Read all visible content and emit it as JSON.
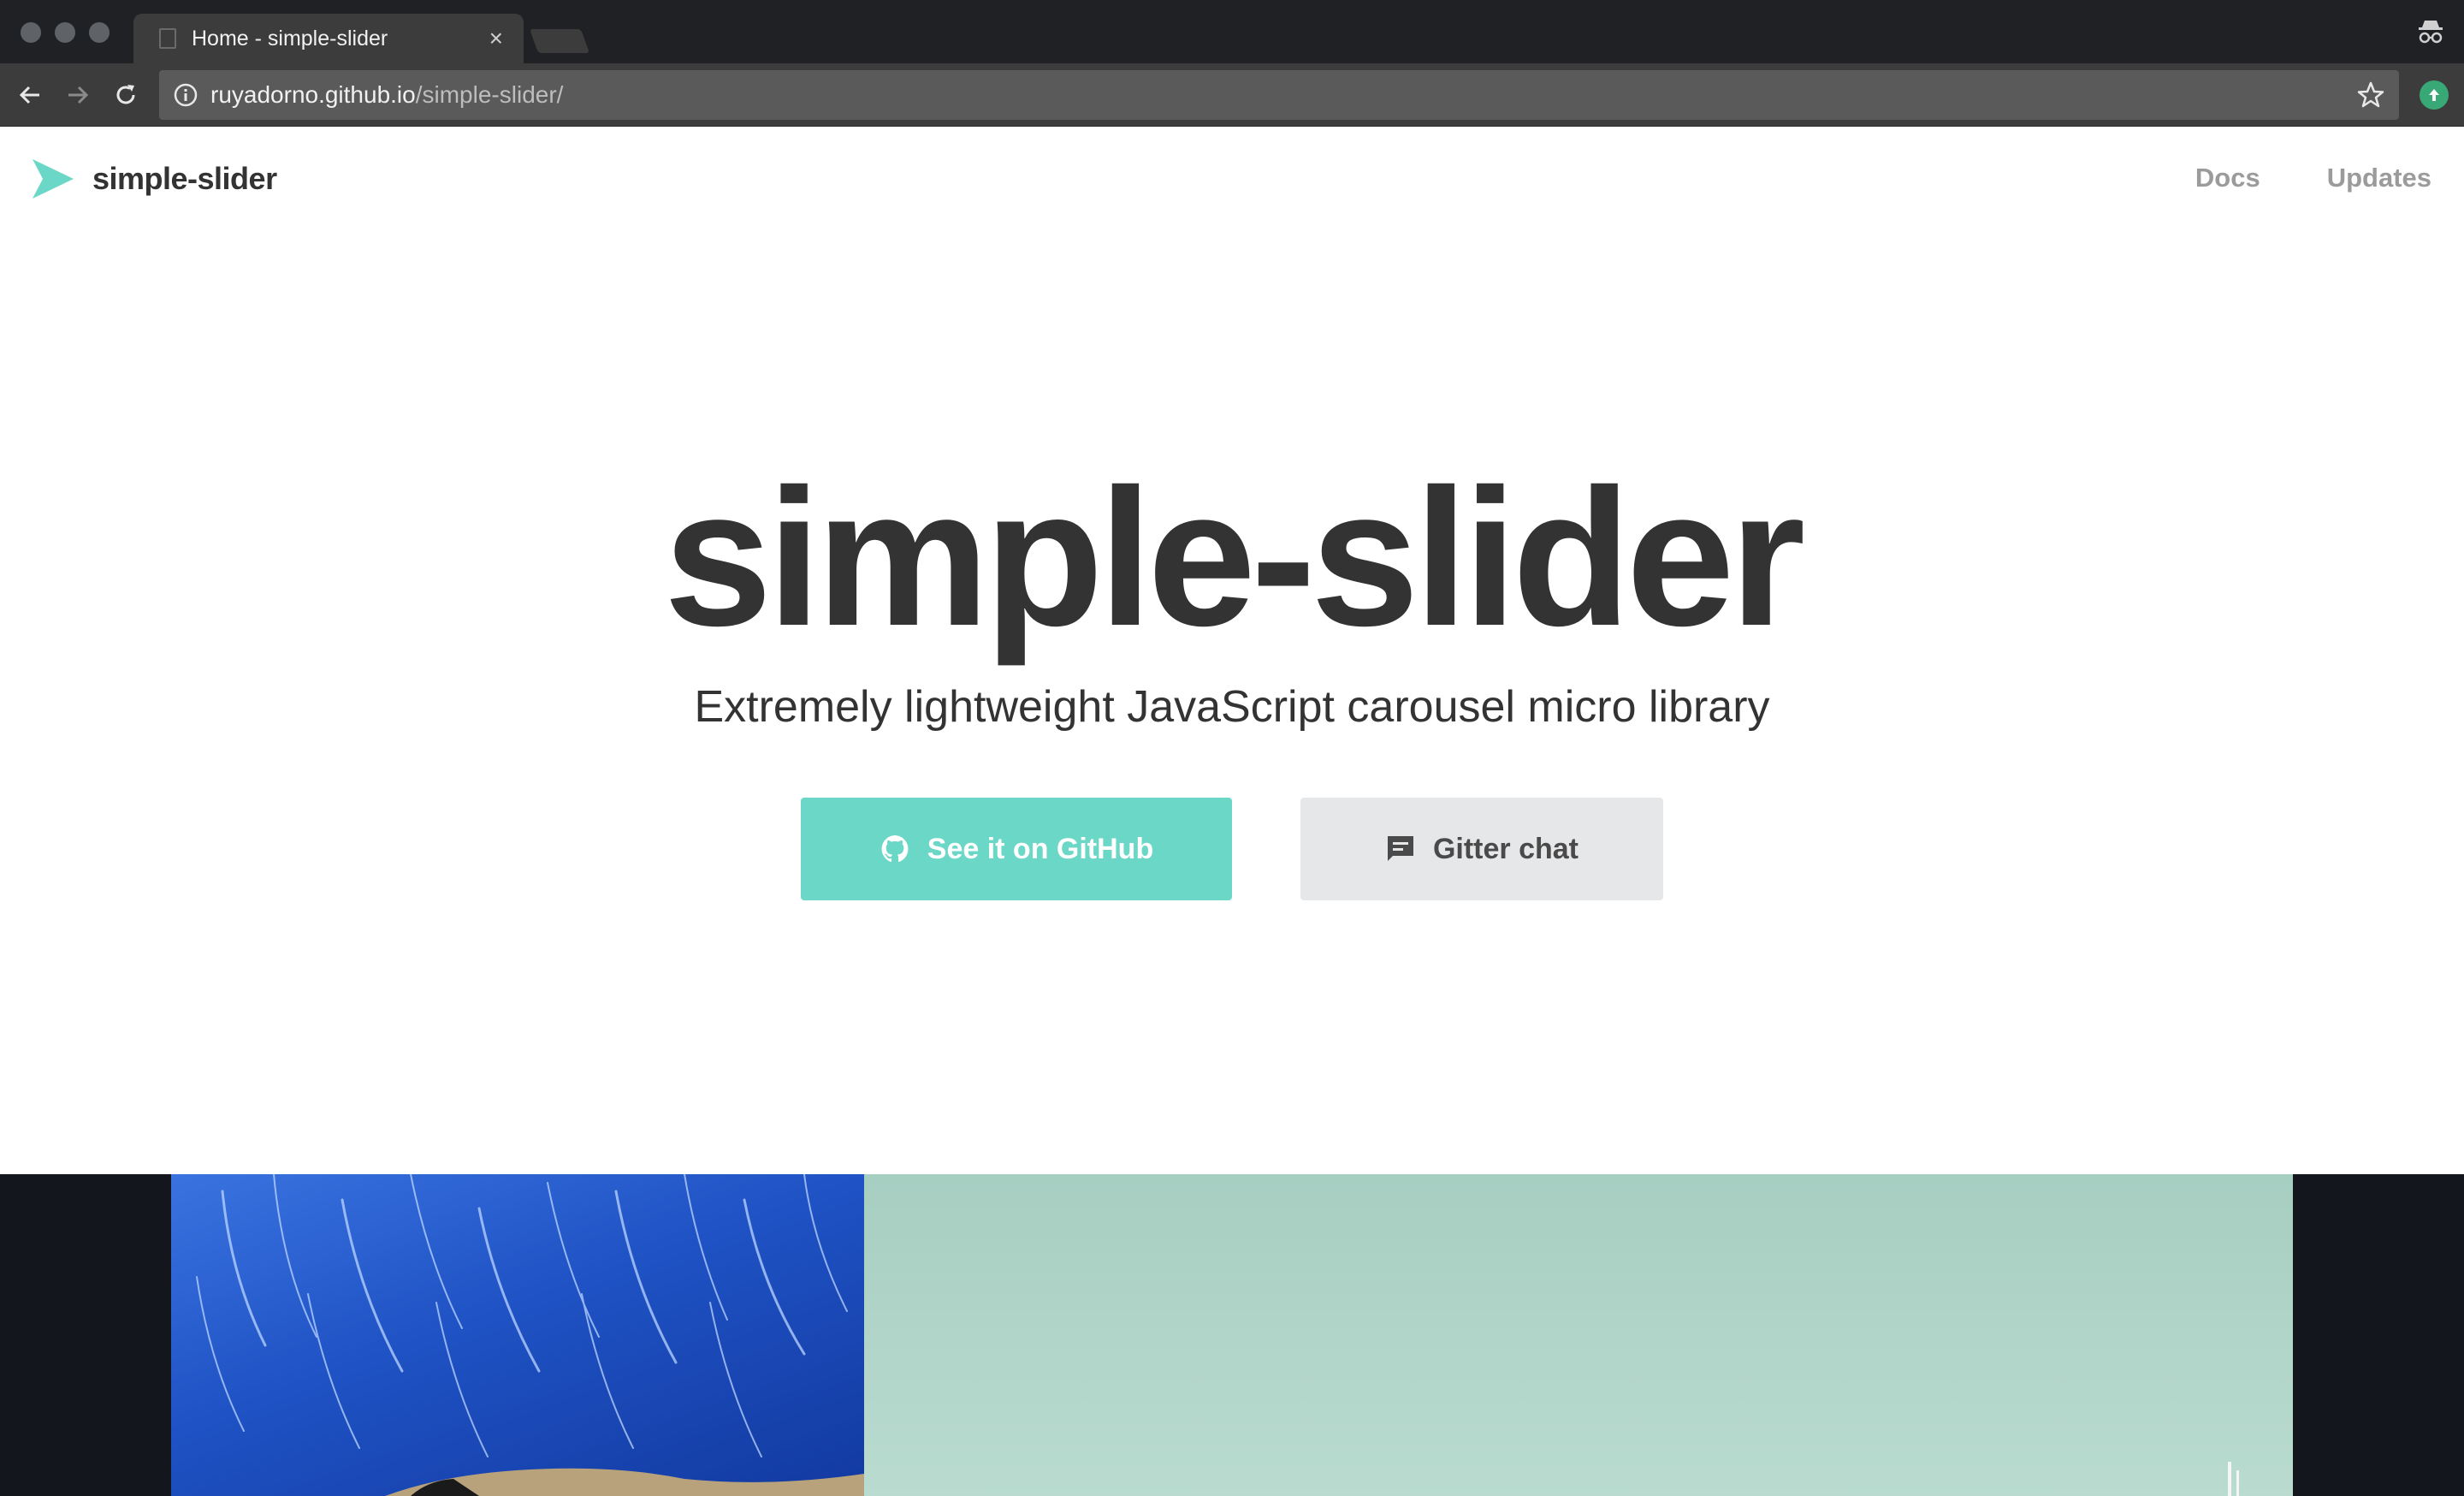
{
  "browser": {
    "tab_title": "Home - simple-slider",
    "tab_close": "×",
    "url_host": "ruyadorno.github.io",
    "url_path": "/simple-slider/",
    "icons": {
      "back": "back-arrow-icon",
      "forward": "forward-arrow-icon",
      "reload": "reload-icon",
      "info": "info-icon",
      "bookmark": "star-icon",
      "extension": "extension-icon",
      "incognito": "incognito-icon"
    }
  },
  "header": {
    "brand": "simple-slider",
    "nav": [
      {
        "label": "Docs"
      },
      {
        "label": "Updates"
      }
    ]
  },
  "hero": {
    "title": "simple-slider",
    "subtitle": "Extremely lightweight JavaScript carousel micro library",
    "buttons": [
      {
        "label": "See it on GitHub",
        "icon": "github-icon",
        "color": "#6ad7c7"
      },
      {
        "label": "Gitter chat",
        "icon": "chat-icon",
        "color": "#e6e7e9"
      }
    ]
  },
  "colors": {
    "accent": "#6ad7c7",
    "text_dark": "#333333",
    "nav_gray": "#9b9b9b",
    "carousel_bg": "#13171d"
  }
}
